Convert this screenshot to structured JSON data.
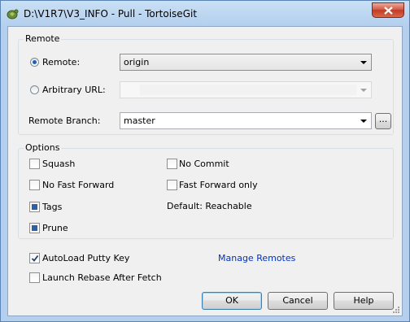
{
  "window": {
    "title": "D:\\V1R7\\V3_INFO - Pull - TortoiseGit"
  },
  "remote_group": {
    "title": "Remote",
    "remote_radio_label": "Remote:",
    "remote_radio_checked": true,
    "remote_value": "origin",
    "arbitrary_url_label": "Arbitrary URL:",
    "arbitrary_url_checked": false,
    "arbitrary_url_value": "",
    "remote_branch_label": "Remote Branch:",
    "remote_branch_value": "master",
    "browse_label": "..."
  },
  "options_group": {
    "title": "Options",
    "squash_label": "Squash",
    "squash_checked": false,
    "no_commit_label": "No Commit",
    "no_commit_checked": false,
    "no_fast_forward_label": "No Fast Forward",
    "no_fast_forward_checked": false,
    "fast_forward_only_label": "Fast Forward only",
    "fast_forward_only_checked": false,
    "tags_label": "Tags",
    "tags_state": "indeterminate",
    "tags_default_text": "Default: Reachable",
    "prune_label": "Prune",
    "prune_state": "indeterminate"
  },
  "bottom": {
    "autoload_putty_label": "AutoLoad Putty Key",
    "autoload_putty_checked": true,
    "manage_remotes_label": "Manage Remotes",
    "launch_rebase_label": "Launch Rebase After Fetch",
    "launch_rebase_checked": false
  },
  "buttons": {
    "ok_label": "OK",
    "cancel_label": "Cancel",
    "help_label": "Help"
  },
  "colors": {
    "link": "#0033bb",
    "title_bar": "#b4d0ee",
    "dialog_bg": "#f0f0f0",
    "indeterminate_fill": "#2a62a9"
  }
}
